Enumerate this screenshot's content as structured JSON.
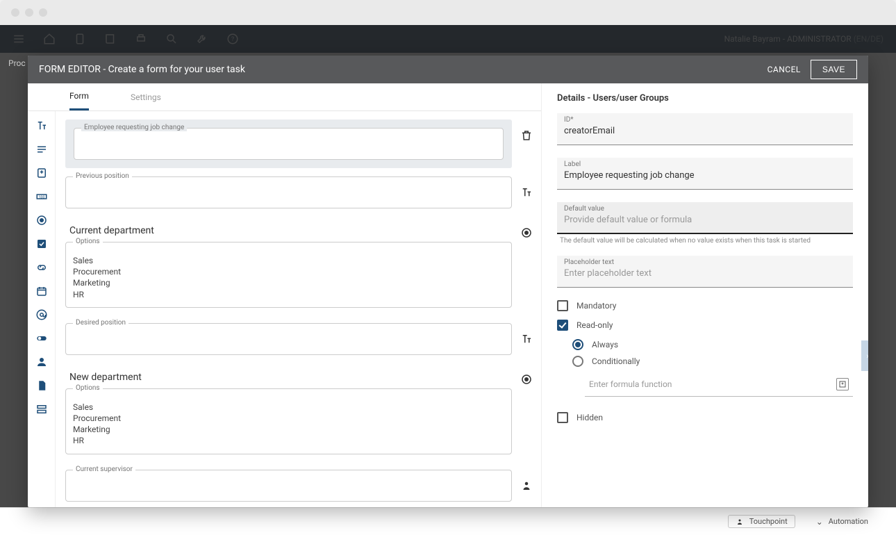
{
  "toolbar": {
    "user": "Natalie Bayram - ADMINISTRATOR",
    "locale": "(EN/DE)"
  },
  "background": {
    "breadcrumb": "Proc",
    "touchpoint": "Touchpoint",
    "automation": "Automation"
  },
  "modal": {
    "title": "FORM EDITOR - Create a form for your user task",
    "cancel": "CANCEL",
    "save": "SAVE"
  },
  "tabs": {
    "form": "Form",
    "settings": "Settings"
  },
  "fields": {
    "f1_label": "Employee requesting job change",
    "f2_label": "Previous position",
    "section1": "Current department",
    "options_label": "Options",
    "opts1": {
      "a": "Sales",
      "b": "Procurement",
      "c": "Marketing",
      "d": "HR"
    },
    "f3_label": "Desired position",
    "section2": "New department",
    "opts2": {
      "a": "Sales",
      "b": "Procurement",
      "c": "Marketing",
      "d": "HR"
    },
    "f4_label": "Current supervisor"
  },
  "details": {
    "title": "Details - Users/user Groups",
    "id_label": "ID*",
    "id_value": "creatorEmail",
    "label_label": "Label",
    "label_value": "Employee requesting job change",
    "default_label": "Default value",
    "default_placeholder": "Provide default value or formula",
    "default_helper": "The default value will be calculated when no value exists when this task is started",
    "placeholder_label": "Placeholder text",
    "placeholder_placeholder": "Enter placeholder text",
    "mandatory": "Mandatory",
    "readonly": "Read-only",
    "always": "Always",
    "conditionally": "Conditionally",
    "formula_placeholder": "Enter formula function",
    "hidden": "Hidden"
  }
}
